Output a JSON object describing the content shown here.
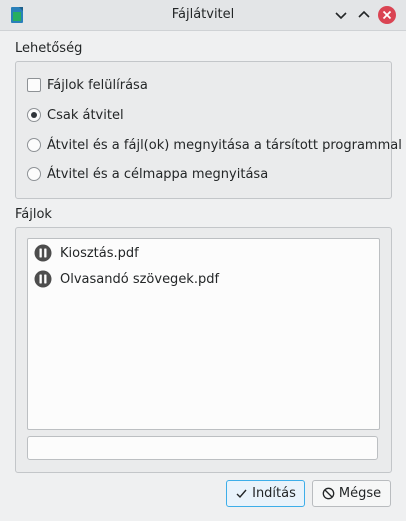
{
  "window": {
    "title": "Fájlátvitel",
    "app_icon": "document-transfer-icon"
  },
  "options": {
    "group_label": "Lehetőség",
    "overwrite": {
      "label": "Fájlok felülírása",
      "checked": false
    },
    "radios": [
      {
        "label": "Csak átvitel",
        "selected": true
      },
      {
        "label": "Átvitel és a fájl(ok) megnyitása a társított programmal",
        "selected": false
      },
      {
        "label": "Átvitel és a célmappa megnyitása",
        "selected": false
      }
    ]
  },
  "files": {
    "group_label": "Fájlok",
    "items": [
      {
        "name": "Kiosztás.pdf",
        "status_icon": "pause-icon"
      },
      {
        "name": "Olvasandó szövegek.pdf",
        "status_icon": "pause-icon"
      }
    ],
    "input_value": ""
  },
  "buttons": {
    "start": "Indítás",
    "cancel": "Mégse"
  },
  "colors": {
    "accent": "#3daee9",
    "close": "#da4453",
    "app_icon_blue": "#2980b9",
    "app_icon_green": "#27ae60"
  }
}
